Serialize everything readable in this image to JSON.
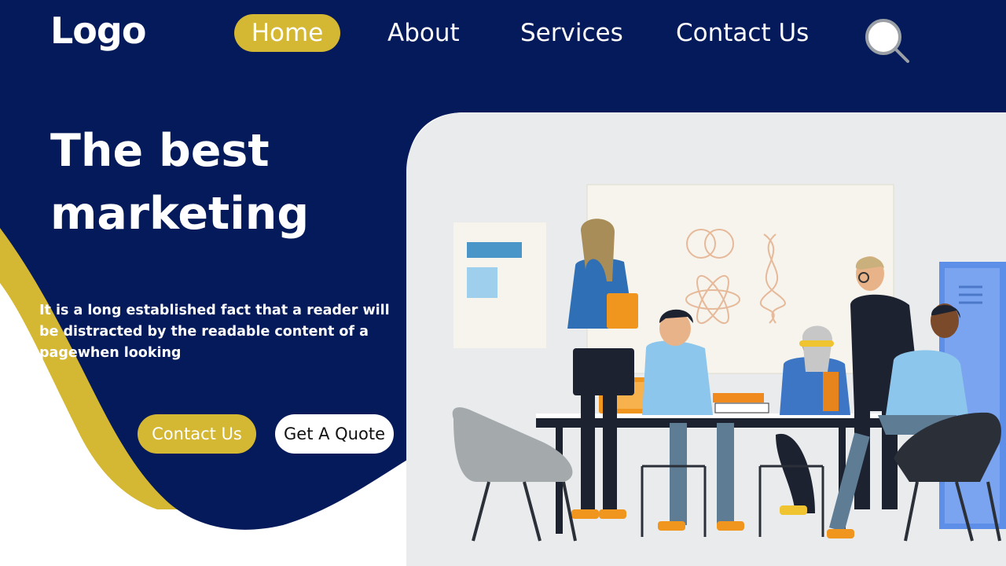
{
  "header": {
    "logo": "Logo",
    "nav": [
      {
        "label": "Home",
        "active": true
      },
      {
        "label": "About"
      },
      {
        "label": "Services"
      },
      {
        "label": "Contact Us"
      }
    ],
    "search_icon": "search-icon"
  },
  "hero": {
    "headline": "The best marketing",
    "body": "It is a long established fact that a reader will be distracted by the readable content of a pagewhen looking",
    "buttons": {
      "contact": "Contact Us",
      "quote": "Get A Quote"
    }
  },
  "colors": {
    "navy": "#041a5a",
    "accent_yellow": "#d4b732",
    "white": "#ffffff",
    "illustration_bg": "#e9ebed"
  }
}
